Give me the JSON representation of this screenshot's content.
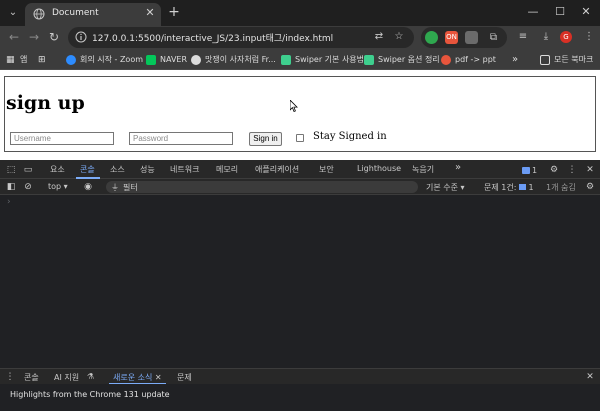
{
  "tab": {
    "title": "Document",
    "close": "✕"
  },
  "toolbar": {
    "url": "127.0.0.1:5500/interactive_JS/23.input태그/index.html",
    "ext_labels": [
      "",
      "ON",
      "",
      ""
    ]
  },
  "bookmarks": {
    "apps_label": "앱",
    "items": [
      "회의 시작 - Zoom",
      "NAVER",
      "맛쟁이 사자처럼 Fr...",
      "Swiper 기본 사용법",
      "Swiper 옵션 정리",
      "pdf -> ppt"
    ],
    "more": "»",
    "all_bookmarks": "모든 북마크"
  },
  "page": {
    "title": "sign up",
    "username_placeholder": "Username",
    "password_placeholder": "Password",
    "signin_label": "Sign in",
    "stay_signed_in": "Stay Signed in"
  },
  "devtools": {
    "tabs": [
      "요소",
      "콘솔",
      "소스",
      "성능",
      "네트워크",
      "메모리",
      "애플리케이션",
      "보안",
      "Lighthouse",
      "녹음기"
    ],
    "more": "»",
    "issues_count": "1",
    "context": "top",
    "filter_placeholder": "필터",
    "levels": "기본 수준",
    "issues_label": "문제 1건:",
    "issues_badge": "1",
    "hidden_count": "1개 숨김",
    "prompt": "›",
    "drawer_tabs": [
      "콘솔",
      "AI 지원",
      "새로운 소식",
      "문제"
    ],
    "whatsnew": "Highlights from the Chrome 131 update"
  },
  "colors": {
    "accent": "#7cacf8",
    "page_bg": "#ffffff",
    "chrome_dark": "#3c3c3c",
    "devtools_bg": "#202124"
  }
}
